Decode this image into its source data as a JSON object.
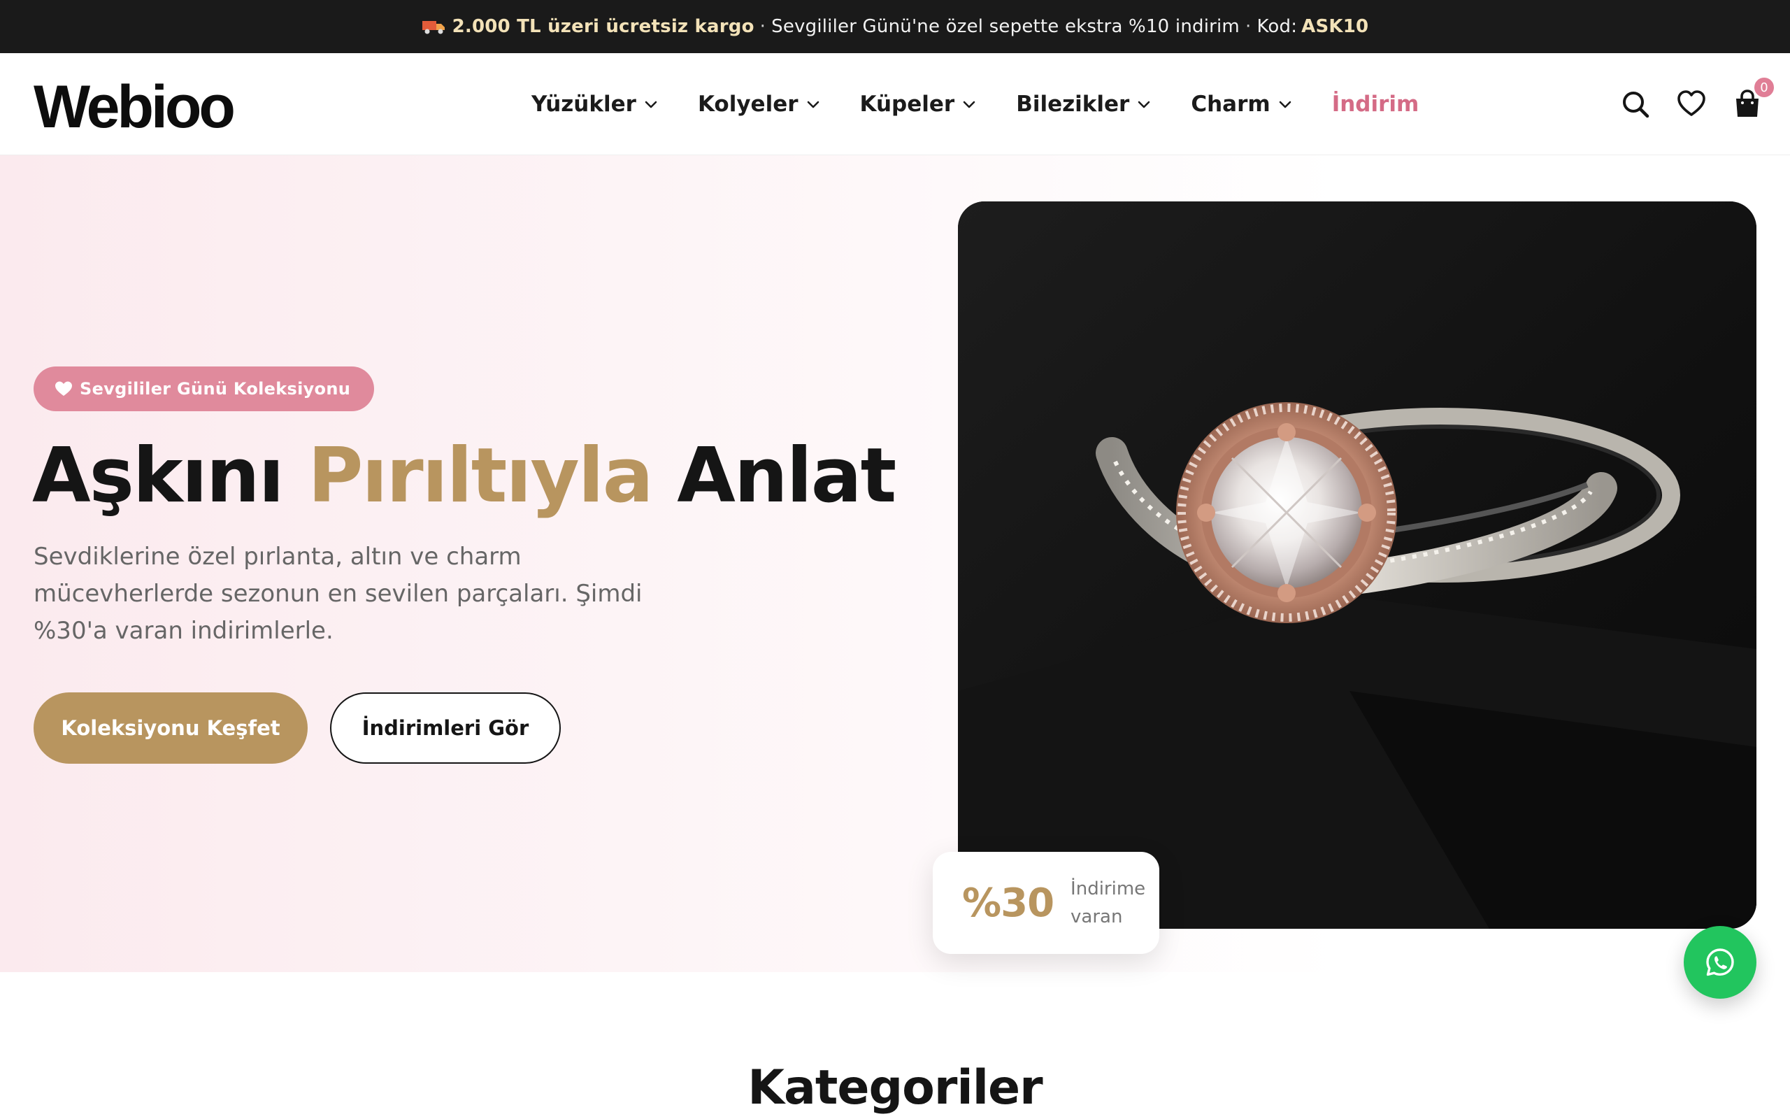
{
  "announcement": {
    "shipping": "2.000 TL üzeri ücretsiz kargo",
    "separator": "·",
    "promo": "Sevgililer Günü'ne özel sepette ekstra %10 indirim",
    "code_label": "Kod:",
    "code": "ASK10",
    "icon": "truck-icon"
  },
  "header": {
    "logo": "Webioo",
    "nav": [
      {
        "label": "Yüzükler"
      },
      {
        "label": "Kolyeler"
      },
      {
        "label": "Küpeler"
      },
      {
        "label": "Bilezikler"
      },
      {
        "label": "Charm"
      },
      {
        "label": "İndirim"
      }
    ],
    "cart_count": "0",
    "icons": [
      "search-icon",
      "heart-icon",
      "shopping-bag-icon"
    ]
  },
  "hero": {
    "badge": "Sevgililer Günü Koleksiyonu",
    "headline_part1": "Aşkını",
    "headline_accent": "Pırıltıyla",
    "headline_part2": "Anlat",
    "description": "Sevdiklerine özel pırlanta, altın ve charm mücevherlerde sezonun en sevilen parçaları. Şimdi %30'a varan indirimlerle.",
    "primary_button": "Koleksiyonu Keşfet",
    "secondary_button": "İndirimleri Gör",
    "discount_value": "%30",
    "discount_label": "İndirime varan"
  },
  "categories": {
    "title": "Kategoriler"
  },
  "colors": {
    "accent_gold": "#b8955f",
    "accent_pink": "#e08a9c",
    "sale_pink": "#d46b86",
    "whatsapp_green": "#22c55e"
  }
}
